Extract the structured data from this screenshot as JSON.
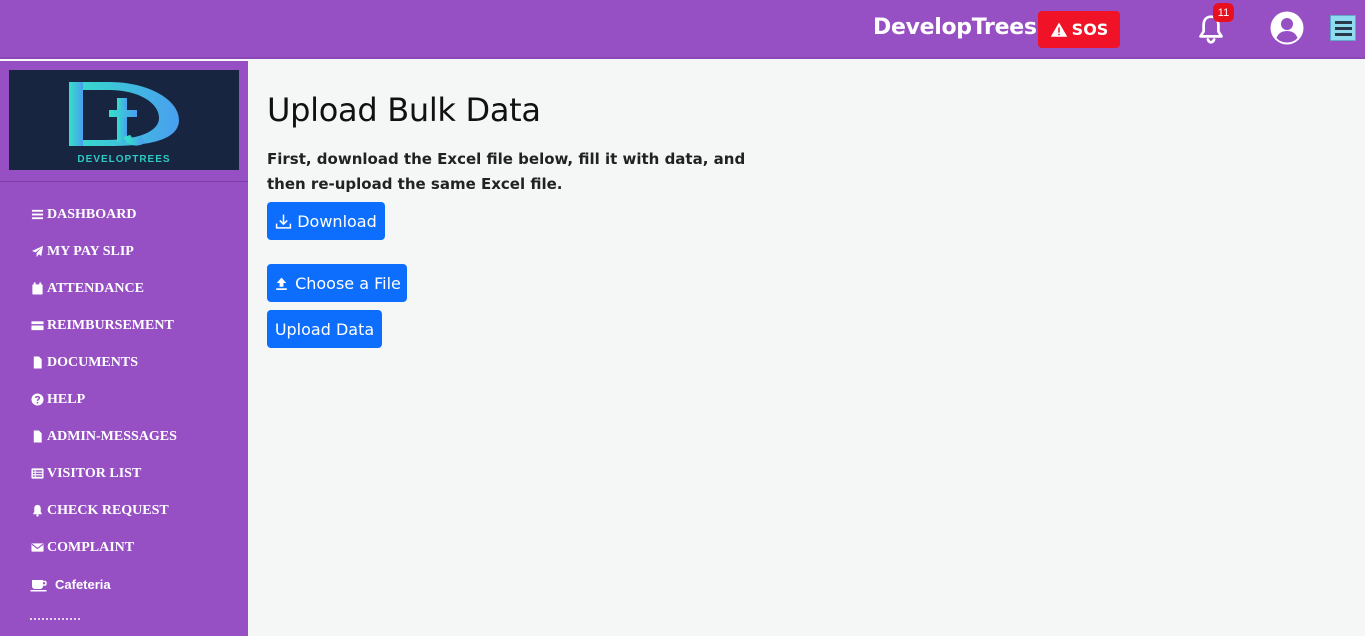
{
  "header": {
    "brand": "DevelopTrees",
    "sos_label": "SOS",
    "notification_count": "11",
    "accent_color": "#9650c4",
    "sos_color": "#f01327"
  },
  "sidebar": {
    "logo_text": "DEVELOPTREES",
    "items": [
      {
        "label": "DASHBOARD",
        "icon": "bars-icon"
      },
      {
        "label": "MY PAY SLIP",
        "icon": "paper-plane-icon"
      },
      {
        "label": "ATTENDANCE",
        "icon": "calendar-icon"
      },
      {
        "label": "REIMBURSEMENT",
        "icon": "credit-card-icon"
      },
      {
        "label": "DOCUMENTS",
        "icon": "file-icon"
      },
      {
        "label": "HELP",
        "icon": "question-circle-icon"
      },
      {
        "label": "ADMIN-MESSAGES",
        "icon": "file-icon"
      },
      {
        "label": "VISITOR LIST",
        "icon": "list-icon"
      },
      {
        "label": "CHECK REQUEST",
        "icon": "bell-icon"
      },
      {
        "label": "COMPLAINT",
        "icon": "envelope-icon"
      },
      {
        "label": "Cafeteria",
        "icon": "coffee-cup-icon"
      }
    ]
  },
  "main": {
    "title": "Upload Bulk Data",
    "instructions": "First, download the Excel file below, fill it with data, and then re-upload the same Excel file.",
    "download_label": "Download",
    "choose_file_label": "Choose a File",
    "upload_label": "Upload Data",
    "button_color": "#0d6efd"
  }
}
